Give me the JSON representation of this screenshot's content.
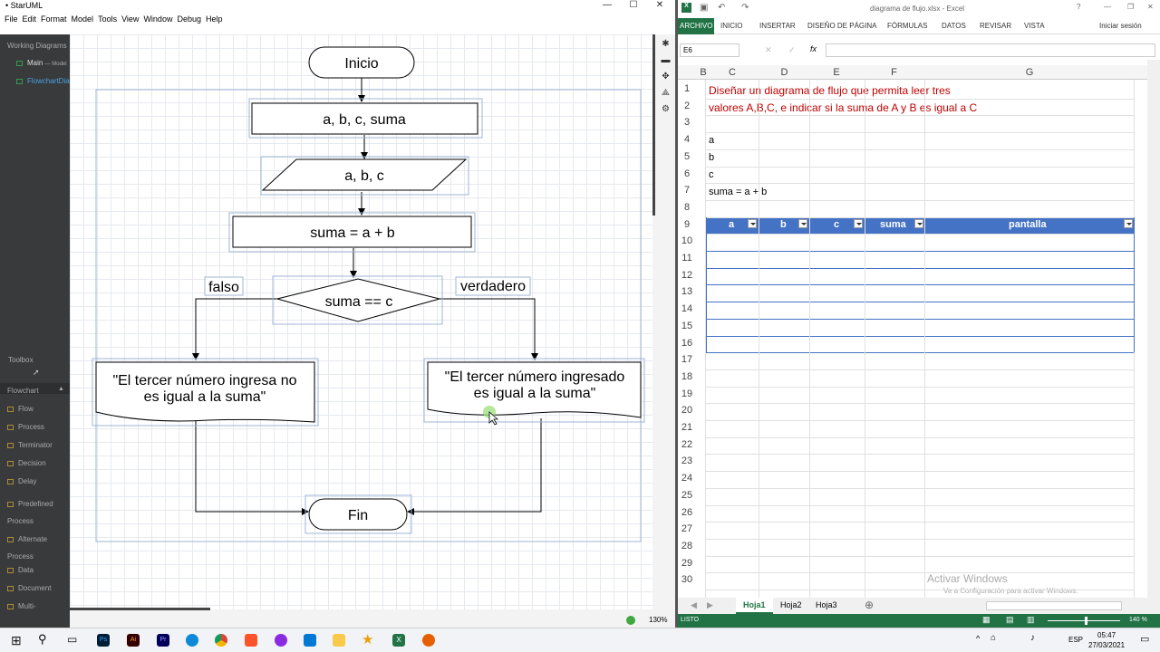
{
  "staruml": {
    "title": "• StarUML",
    "window_controls": [
      "—",
      "☐",
      "✕"
    ],
    "menu": [
      "File",
      "Edit",
      "Format",
      "Model",
      "Tools",
      "View",
      "Window",
      "Debug",
      "Help"
    ],
    "sidebar": {
      "working_diagrams_label": "Working Diagrams",
      "items": [
        {
          "name": "Main",
          "suffix": "— Model"
        },
        {
          "name": "FlowchartDiag",
          "suffix": ""
        }
      ],
      "toolbox_label": "Toolbox",
      "section_label": "Flowchart",
      "tools": [
        "Flow",
        "Process",
        "Terminator",
        "Decision",
        "Delay",
        "Predefined Process",
        "Alternate Process",
        "Data",
        "Document",
        "Multi-"
      ]
    },
    "status": {
      "zoom": "130%"
    },
    "diagram": {
      "start": "Inicio",
      "process1": "a, b, c, suma",
      "input": "a, b, c",
      "process2": "suma = a + b",
      "decision": "suma == c",
      "false_label": "falso",
      "true_label": "verdadero",
      "doc_false": "\"El tercer número ingresa no es igual a la suma\"",
      "doc_true": "\"El tercer número ingresado es igual a la suma\"",
      "end": "Fin"
    }
  },
  "excel": {
    "title": "diagrama de flujo.xlsx - Excel",
    "tabs": [
      "ARCHIVO",
      "INICIO",
      "INSERTAR",
      "DISEÑO DE PÁGINA",
      "FÓRMULAS",
      "DATOS",
      "REVISAR",
      "VISTA"
    ],
    "signin": "Iniciar sesión",
    "namebox": "E6",
    "fx_label": "fx",
    "columns": [
      "B",
      "C",
      "D",
      "E",
      "F",
      "G"
    ],
    "rows": [
      "1",
      "2",
      "3",
      "4",
      "5",
      "6",
      "7",
      "8",
      "9",
      "10",
      "11",
      "12",
      "13",
      "14",
      "15",
      "16",
      "17",
      "18",
      "19",
      "20",
      "21",
      "22",
      "23",
      "24",
      "25",
      "26",
      "27",
      "28",
      "29",
      "30"
    ],
    "cells": {
      "r1": "Diseñar un diagrama de flujo que permita leer tres",
      "r2": "valores A,B,C, e indicar si la suma de A y B es igual a C",
      "r4": "a",
      "r5": "b",
      "r6": "c",
      "r7": "suma = a + b"
    },
    "table_headers": [
      "a",
      "b",
      "c",
      "suma",
      "pantalla"
    ],
    "watermark_title": "Activar Windows",
    "watermark_sub": "Ve a Configuración para activar Windows.",
    "sheets": [
      "Hoja1",
      "Hoja2",
      "Hoja3"
    ],
    "status_left": "LISTO",
    "zoom": "140 %",
    "accent_color": "#217346",
    "header_color": "#4472c4"
  },
  "taskbar": {
    "lang": "ESP",
    "time": "05:47",
    "date": "27/03/2021"
  }
}
